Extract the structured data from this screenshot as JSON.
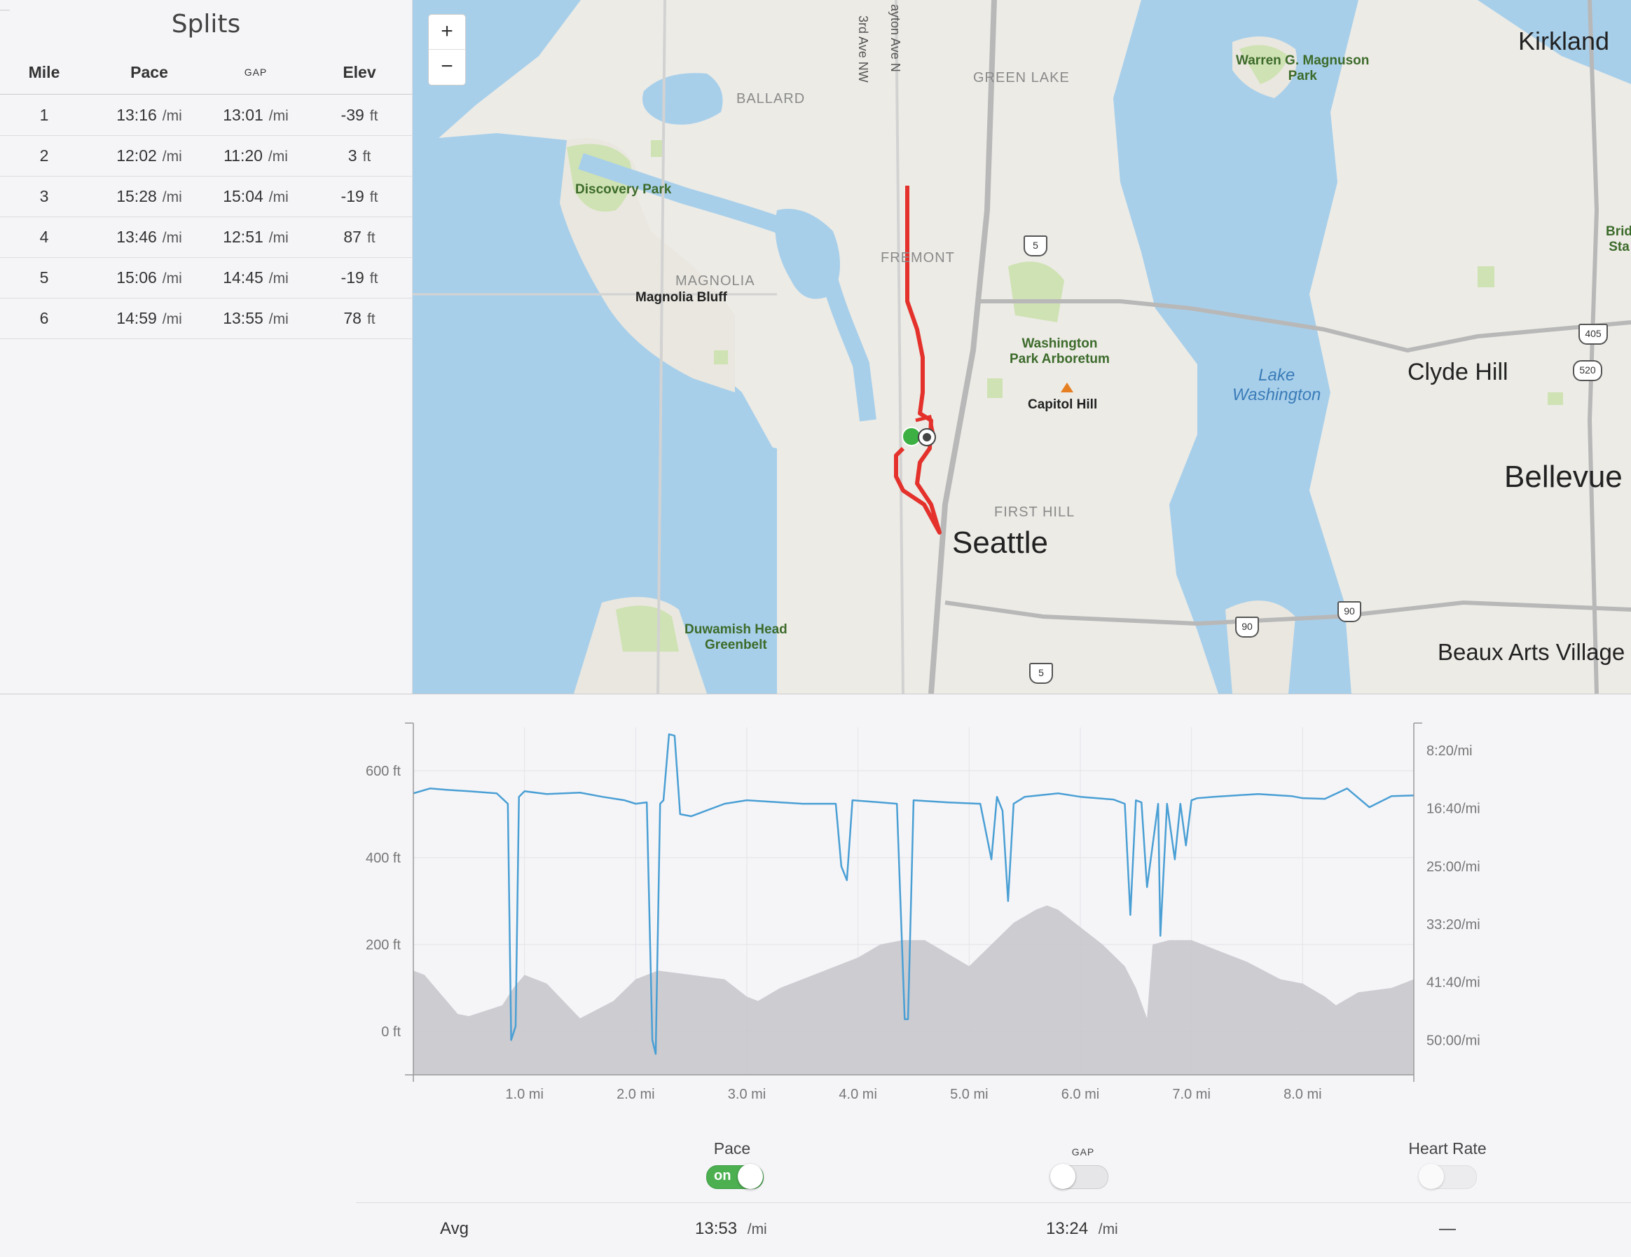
{
  "splits": {
    "title": "Splits",
    "headers": {
      "mile": "Mile",
      "pace": "Pace",
      "gap": "GAP",
      "elev": "Elev"
    },
    "rows": [
      {
        "mile": "1",
        "pace": "13:16",
        "pace_unit": "/mi",
        "gap": "13:01",
        "gap_unit": "/mi",
        "elev": "-39",
        "elev_unit": "ft"
      },
      {
        "mile": "2",
        "pace": "12:02",
        "pace_unit": "/mi",
        "gap": "11:20",
        "gap_unit": "/mi",
        "elev": "3",
        "elev_unit": "ft"
      },
      {
        "mile": "3",
        "pace": "15:28",
        "pace_unit": "/mi",
        "gap": "15:04",
        "gap_unit": "/mi",
        "elev": "-19",
        "elev_unit": "ft"
      },
      {
        "mile": "4",
        "pace": "13:46",
        "pace_unit": "/mi",
        "gap": "12:51",
        "gap_unit": "/mi",
        "elev": "87",
        "elev_unit": "ft"
      },
      {
        "mile": "5",
        "pace": "15:06",
        "pace_unit": "/mi",
        "gap": "14:45",
        "gap_unit": "/mi",
        "elev": "-19",
        "elev_unit": "ft"
      },
      {
        "mile": "6",
        "pace": "14:59",
        "pace_unit": "/mi",
        "gap": "13:55",
        "gap_unit": "/mi",
        "elev": "78",
        "elev_unit": "ft"
      }
    ]
  },
  "map": {
    "zoom_in": "+",
    "zoom_out": "−",
    "labels": {
      "kirkland": "Kirkland",
      "green_lake": "GREEN LAKE",
      "ballard": "BALLARD",
      "third_ave": "3rd Ave NW",
      "dayton_ave": "ayton Ave N",
      "magnuson_1": "Warren G. Magnuson",
      "magnuson_2": "Park",
      "discovery_park": "Discovery Park",
      "fremont": "FREMONT",
      "magnolia": "MAGNOLIA",
      "magnolia_bluff": "Magnolia Bluff",
      "arboretum_1": "Washington",
      "arboretum_2": "Park Arboretum",
      "capitol_hill": "Capitol Hill",
      "lake_1": "Lake",
      "lake_2": "Washington",
      "clyde_hill": "Clyde Hill",
      "bellevue": "Bellevue",
      "first_hill": "FIRST HILL",
      "seattle": "Seattle",
      "duwamish_1": "Duwamish Head",
      "duwamish_2": "Greenbelt",
      "beaux_arts": "Beaux Arts Village",
      "bridle_1": "Brid",
      "bridle_2": "Sta"
    },
    "highways": {
      "i5": "5",
      "i5b": "5",
      "i90a": "90",
      "i90b": "90",
      "i405": "405",
      "sr520": "520"
    }
  },
  "chart_data": {
    "type": "area",
    "x_ticks": [
      "1.0 mi",
      "2.0 mi",
      "3.0 mi",
      "4.0 mi",
      "5.0 mi",
      "6.0 mi",
      "7.0 mi",
      "8.0 mi"
    ],
    "x_tick_values": [
      1,
      2,
      3,
      4,
      5,
      6,
      7,
      8
    ],
    "xlim": [
      0,
      9.0
    ],
    "y_left_ticks": [
      "600 ft",
      "400 ft",
      "200 ft",
      "0 ft"
    ],
    "y_left_values": [
      600,
      400,
      200,
      0
    ],
    "ylim_left": [
      -100,
      700
    ],
    "y_right_ticks": [
      "8:20/mi",
      "16:40/mi",
      "25:00/mi",
      "33:20/mi",
      "41:40/mi",
      "50:00/mi"
    ],
    "y_right_values": [
      8.333,
      16.667,
      25,
      33.333,
      41.667,
      50
    ],
    "ylim_right": [
      5,
      55
    ],
    "series": [
      {
        "name": "elevation",
        "color": "#c9c9cf",
        "x": [
          0,
          0.1,
          0.4,
          0.5,
          0.8,
          0.9,
          1.0,
          1.2,
          1.5,
          1.8,
          2.0,
          2.2,
          2.5,
          2.8,
          3.0,
          3.1,
          3.3,
          3.5,
          3.8,
          4.0,
          4.2,
          4.4,
          4.6,
          4.8,
          5.0,
          5.2,
          5.4,
          5.6,
          5.7,
          5.8,
          6.0,
          6.2,
          6.4,
          6.5,
          6.6,
          6.65,
          6.8,
          7.0,
          7.2,
          7.5,
          7.8,
          8.0,
          8.2,
          8.3,
          8.5,
          8.8,
          9.0
        ],
        "y": [
          140,
          130,
          40,
          35,
          60,
          100,
          130,
          110,
          30,
          70,
          120,
          140,
          130,
          120,
          80,
          70,
          100,
          120,
          150,
          170,
          200,
          210,
          210,
          180,
          150,
          200,
          250,
          280,
          290,
          280,
          240,
          200,
          150,
          100,
          30,
          200,
          210,
          210,
          190,
          160,
          120,
          110,
          80,
          60,
          90,
          100,
          120
        ]
      },
      {
        "name": "pace",
        "color": "#4a9fd4",
        "x": [
          0,
          0.15,
          0.3,
          0.5,
          0.75,
          0.85,
          0.88,
          0.92,
          0.95,
          1.0,
          1.2,
          1.5,
          1.7,
          1.9,
          2.0,
          2.1,
          2.15,
          2.18,
          2.22,
          2.25,
          2.3,
          2.35,
          2.4,
          2.5,
          2.8,
          3.0,
          3.3,
          3.5,
          3.8,
          3.85,
          3.9,
          3.95,
          4.2,
          4.35,
          4.42,
          4.45,
          4.5,
          4.6,
          4.8,
          5.1,
          5.2,
          5.25,
          5.3,
          5.35,
          5.4,
          5.45,
          5.5,
          5.8,
          6.0,
          6.3,
          6.4,
          6.45,
          6.5,
          6.55,
          6.6,
          6.7,
          6.72,
          6.78,
          6.85,
          6.9,
          6.95,
          7.0,
          7.05,
          7.2,
          7.6,
          7.9,
          8.0,
          8.2,
          8.4,
          8.6,
          8.8,
          9.0
        ],
        "y": [
          14.5,
          13.8,
          14.0,
          14.2,
          14.5,
          16,
          50,
          48,
          15,
          14.2,
          14.6,
          14.4,
          15,
          15.5,
          16,
          15.8,
          50,
          52,
          16,
          15.5,
          6,
          6.2,
          17.5,
          17.8,
          16,
          15.5,
          15.8,
          16.0,
          16,
          25,
          27,
          15.5,
          15.8,
          16,
          47,
          47,
          15.5,
          15.6,
          15.8,
          16,
          24,
          15,
          17,
          30,
          16,
          15.5,
          15,
          14.5,
          15.0,
          15.4,
          16,
          32,
          15.5,
          15.8,
          28,
          16,
          35,
          16,
          24,
          16,
          22,
          15.5,
          15.2,
          15,
          14.6,
          14.9,
          15.2,
          15.3,
          13.8,
          16.5,
          14.9,
          14.8
        ]
      }
    ]
  },
  "toggles": {
    "pace": {
      "label": "Pace",
      "state": "on",
      "on_text": "on"
    },
    "gap": {
      "label": "GAP",
      "state": "off"
    },
    "heart_rate": {
      "label": "Heart Rate",
      "state": "off"
    }
  },
  "averages": {
    "label": "Avg",
    "pace": "13:53",
    "pace_unit": "/mi",
    "gap": "13:24",
    "gap_unit": "/mi",
    "heart_rate": "—"
  }
}
